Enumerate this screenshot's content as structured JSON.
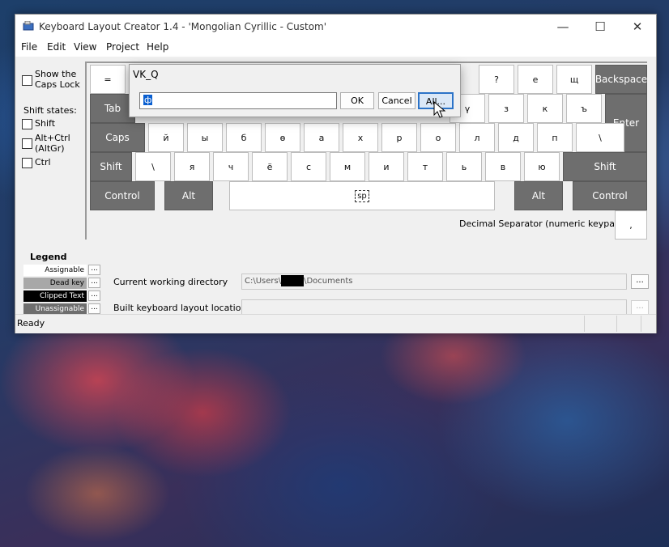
{
  "window": {
    "title": "Keyboard Layout Creator 1.4 - 'Mongolian Cyrillic - Custom'",
    "controls": {
      "minimize": "—",
      "maximize": "☐",
      "close": "✕"
    }
  },
  "menu": [
    "File",
    "Edit",
    "View",
    "Project",
    "Help"
  ],
  "left_panel": {
    "show_caps_label": "Show the Caps Lock",
    "shift_states_title": "Shift states:",
    "shift": "Shift",
    "altgr": "Alt+Ctrl (AltGr)",
    "ctrl": "Ctrl"
  },
  "keyboard": {
    "row1": [
      "=",
      "",
      "",
      "",
      "",
      "",
      "",
      "",
      "",
      "",
      "?",
      "е",
      "щ"
    ],
    "backspace": "Backspace",
    "tab": "Tab",
    "row2": [
      "ү",
      "з",
      "к",
      "ъ"
    ],
    "enter": "Enter",
    "caps": "Caps",
    "row3": [
      "й",
      "ы",
      "б",
      "ө",
      "а",
      "х",
      "р",
      "о",
      "л",
      "д",
      "п",
      "\\"
    ],
    "shift_left": "Shift",
    "row4": [
      "\\",
      "я",
      "ч",
      "ё",
      "с",
      "м",
      "и",
      "т",
      "ь",
      "в",
      "ю"
    ],
    "shift_right": "Shift",
    "control_left": "Control",
    "alt_left": "Alt",
    "space": "sp",
    "alt_right": "Alt",
    "control_right": "Control",
    "decimal_label": "Decimal Separator (numeric keypad)",
    "decimal_key": ","
  },
  "legend": {
    "title": "Legend",
    "items": [
      "Assignable",
      "Dead key",
      "Clipped Text",
      "Unassignable"
    ],
    "button": "..."
  },
  "paths": {
    "cwd_label": "Current working directory",
    "cwd_value_prefix": "C:\\Users\\",
    "cwd_value_suffix": "\\Documents",
    "built_label": "Built keyboard layout location",
    "built_value": "",
    "browse": "..."
  },
  "status": {
    "text": "Ready"
  },
  "dialog": {
    "title": "VK_Q",
    "input_value": "ф",
    "ok": "OK",
    "cancel": "Cancel",
    "all": "All..."
  },
  "colors": {
    "legend_assignable": "#ffffff",
    "legend_dead": "#a8a8a8",
    "legend_clipped": "#000000",
    "legend_unassignable": "#6e6e6e",
    "key_dark": "#6e6e6e",
    "selection": "#0a5fd0"
  }
}
